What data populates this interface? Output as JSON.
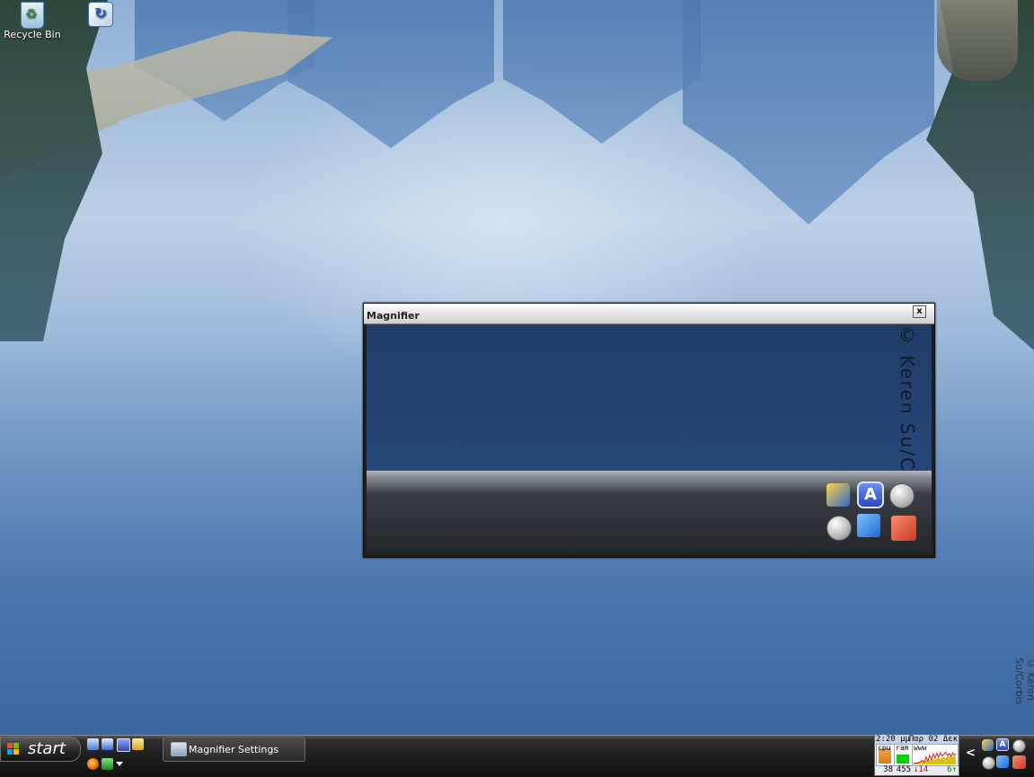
{
  "desktop": {
    "icons": [
      {
        "label": "Recycle Bin",
        "icon": "recycle-bin-icon"
      },
      {
        "label": "",
        "icon": "shortcut-icon"
      }
    ],
    "watermark": "© Keren Su/Corbis"
  },
  "magnifier": {
    "title": "Magnifier",
    "close_label": "x",
    "zoomed_watermark": "© Keren Su/Cor"
  },
  "monitor": {
    "time": "2:20 μμ",
    "date": "Παρ 02 Δεκ",
    "cpu_label": "cpu",
    "ram_label": "ram",
    "net_label": "www",
    "cpu_value": "38",
    "ram_value": "455",
    "down_value": "↓14",
    "up_value": "6↑",
    "cpu_fill_fraction": 0.9,
    "ram_fill_fraction": 0.55,
    "colors": {
      "cpu": "#e08a2a",
      "ram": "#00d400",
      "down": "#d10000",
      "up": "#007a00"
    }
  },
  "tray": {
    "chevron": "<",
    "icons": [
      "disk-icon",
      "accessibility-icon",
      "orb-icon",
      "orb-icon",
      "network-icon",
      "user-icon"
    ]
  },
  "taskbar": {
    "start_label": "start",
    "quicklaunch": [
      "show-desktop-icon",
      "window-switch-icon",
      "accessibility-icon",
      "folder-icon",
      "firefox-icon",
      "run-icon",
      "dropdown-icon"
    ],
    "tasks": [
      {
        "label": "Magnifier Settings",
        "icon": "magnifier-settings-icon"
      }
    ]
  }
}
